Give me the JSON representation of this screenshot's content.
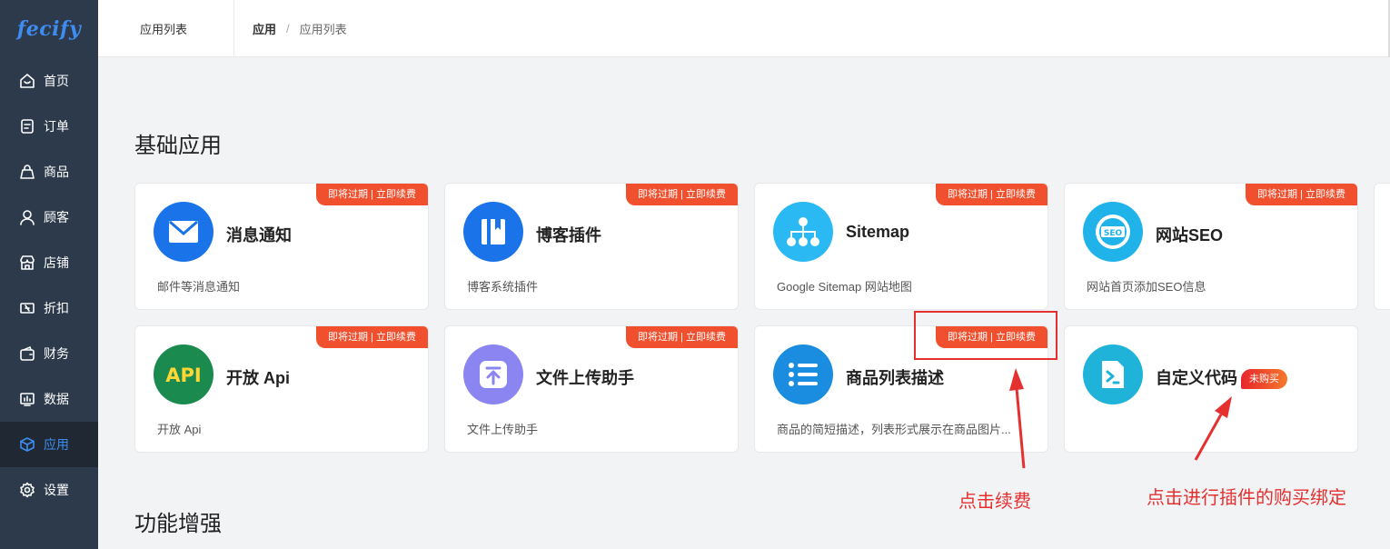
{
  "logo": {
    "text": "fecify"
  },
  "sidebar": {
    "items": [
      {
        "label": "首页",
        "icon": "home-icon"
      },
      {
        "label": "订单",
        "icon": "order-icon"
      },
      {
        "label": "商品",
        "icon": "bag-icon"
      },
      {
        "label": "顾客",
        "icon": "user-icon"
      },
      {
        "label": "店铺",
        "icon": "store-icon"
      },
      {
        "label": "折扣",
        "icon": "ticket-icon"
      },
      {
        "label": "财务",
        "icon": "wallet-icon"
      },
      {
        "label": "数据",
        "icon": "chart-icon"
      },
      {
        "label": "应用",
        "icon": "box-icon",
        "active": true
      },
      {
        "label": "设置",
        "icon": "gear-icon"
      }
    ]
  },
  "header": {
    "tab": "应用列表",
    "breadcrumb": {
      "parent": "应用",
      "separator": "/",
      "current": "应用列表"
    }
  },
  "sections": {
    "basic": "基础应用",
    "enhance": "功能增强"
  },
  "badge_text": "即将过期 | 立即续费",
  "unpaid_label": "未购买",
  "apps": [
    {
      "name": "消息通知",
      "desc": "邮件等消息通知",
      "icon": "mail-icon",
      "color": "#1a73e8"
    },
    {
      "name": "博客插件",
      "desc": "博客系统插件",
      "icon": "blog-icon",
      "color": "#1a73e8"
    },
    {
      "name": "Sitemap",
      "desc": "Google Sitemap 网站地图",
      "icon": "sitemap-icon",
      "color": "#2bb9f3"
    },
    {
      "name": "网站SEO",
      "desc": "网站首页添加SEO信息",
      "icon": "seo-icon",
      "color": "#1fb3ea"
    },
    {
      "name": "开放 Api",
      "desc": "开放 Api",
      "icon": "api-icon",
      "color": "#1a8a4e"
    },
    {
      "name": "文件上传助手",
      "desc": "文件上传助手",
      "icon": "upload-icon",
      "color": "#8b85f2"
    },
    {
      "name": "商品列表描述",
      "desc": "商品的简短描述，列表形式展示在商品图片...",
      "icon": "list-icon",
      "color": "#1a8de0"
    },
    {
      "name": "自定义代码",
      "desc": "",
      "icon": "code-icon",
      "color": "#1fb3d9"
    }
  ],
  "annotations": {
    "renew": "点击续费",
    "purchase": "点击进行插件的购买绑定"
  },
  "colors": {
    "sidebar": "#2c3a4b",
    "active_bg": "#1f2833",
    "accent": "#3f8cf0",
    "badge": "#f0502e",
    "annotation": "#e53030"
  }
}
